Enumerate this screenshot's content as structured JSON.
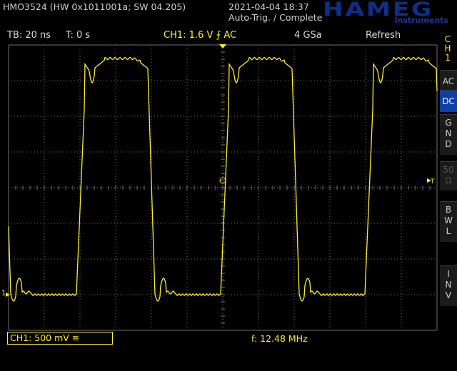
{
  "header": {
    "device": "HMO3524 (HW 0x1011001a; SW 04.205)",
    "datetime": "2021-04-04 18:37",
    "trigger_status": "Auto-Trig. / Complete",
    "logo_brand": "HAMEG",
    "logo_sub": "Instruments"
  },
  "status_bar": {
    "timebase": "TB: 20 ns",
    "trigger_time": "T: 0 s",
    "channel_info": "CH1: 1.6 V ⨍ AC",
    "sample_rate": "4 GSa",
    "mode": "Refresh"
  },
  "side_panel": {
    "channel": [
      "C",
      "H",
      "1"
    ],
    "buttons": [
      {
        "label": "AC",
        "active": false,
        "enabled": true
      },
      {
        "label": "DC",
        "active": true,
        "enabled": true
      },
      {
        "label": "G\nN\nD",
        "active": false,
        "enabled": true
      },
      {
        "label": "50\nΩ",
        "active": false,
        "enabled": false
      },
      {
        "label": "B\nW\nL",
        "active": false,
        "enabled": true
      },
      {
        "label": "I\nN\nV",
        "active": false,
        "enabled": true
      }
    ]
  },
  "footer": {
    "channel_scale": "CH1: 500 mV ≅",
    "frequency": "f: 12.48 MHz"
  },
  "markers": {
    "channel_marker": "1",
    "trigger_marker": "T"
  },
  "colors": {
    "trace": "#ffee33",
    "grid": "#6f6f6f",
    "active_button": "#0d3fa6",
    "logo": "#0f2f86"
  }
}
